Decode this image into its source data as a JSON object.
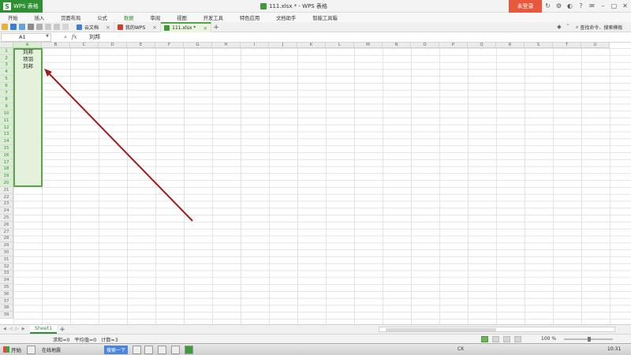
{
  "app": {
    "button_label": "WPS 表格",
    "window_title": "111.xlsx * - WPS 表格",
    "login_label": "未登录"
  },
  "menu": [
    "开始",
    "插入",
    "页面布局",
    "公式",
    "数据",
    "审阅",
    "视图",
    "开发工具",
    "特色应用",
    "文档助手",
    "智能工具箱"
  ],
  "menu_active": "数据",
  "doc_tabs": [
    {
      "label": "云文档",
      "icon": "cloud-icon",
      "color": "#3b7fd8"
    },
    {
      "label": "我的WPS",
      "icon": "wps-icon",
      "color": "#d33b2c"
    },
    {
      "label": "111.xlsx *",
      "icon": "sheet-icon",
      "color": "#3c9a3c"
    }
  ],
  "search_command": "查找命令、搜索模板",
  "formula_bar": {
    "name_box": "A1",
    "formula_value": "刘邦"
  },
  "columns": [
    "A",
    "B",
    "C",
    "D",
    "E",
    "F",
    "G",
    "H",
    "I",
    "J",
    "K",
    "L",
    "M",
    "N",
    "O",
    "P",
    "Q",
    "R",
    "S",
    "T",
    "U"
  ],
  "rows": [
    "1",
    "2",
    "3",
    "4",
    "5",
    "6",
    "7",
    "8",
    "9",
    "10",
    "11",
    "12",
    "13",
    "14",
    "15",
    "16",
    "17",
    "18",
    "19",
    "20",
    "21",
    "22",
    "23",
    "24",
    "25",
    "26",
    "27",
    "28",
    "29",
    "30",
    "31",
    "32",
    "33",
    "34",
    "35",
    "36",
    "37",
    "38",
    "39"
  ],
  "cells": [
    {
      "ref": "A1",
      "value": "刘邦"
    },
    {
      "ref": "A2",
      "value": "项羽"
    },
    {
      "ref": "A3",
      "value": "刘邦"
    }
  ],
  "selection": "A1:A20",
  "sheet": {
    "active_tab": "Sheet1"
  },
  "status": {
    "sum": "求和=0",
    "average": "平均值=0",
    "count": "计数=3",
    "zoom": "100 %"
  },
  "taskbar": {
    "start_label": "开始",
    "items": [
      "在线地震",
      "搜索一下"
    ],
    "input_indicator": "CK",
    "clock": "10:31"
  },
  "colors": {
    "brand_green": "#2f8f33",
    "selection_fill": "#e4f2db",
    "arrow_red": "#a01c1c",
    "login_orange": "#e8583c"
  }
}
